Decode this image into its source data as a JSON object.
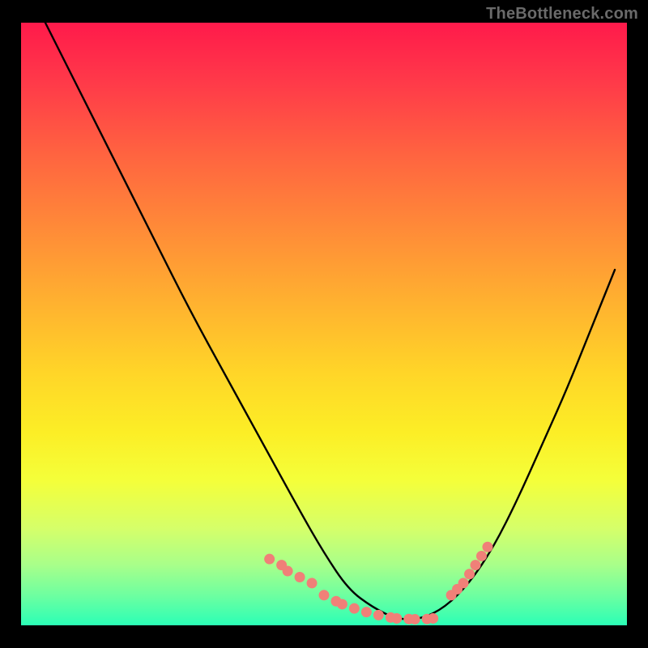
{
  "watermark": "TheBottleneck.com",
  "chart_data": {
    "type": "line",
    "title": "",
    "xlabel": "",
    "ylabel": "",
    "xlim": [
      0,
      100
    ],
    "ylim": [
      0,
      100
    ],
    "grid": false,
    "series": [
      {
        "name": "bottleneck-curve",
        "color": "#000000",
        "x": [
          4,
          10,
          16,
          22,
          28,
          34,
          40,
          46,
          50,
          54,
          58,
          62,
          66,
          70,
          74,
          78,
          82,
          86,
          90,
          94,
          98
        ],
        "y": [
          100,
          88,
          76,
          64,
          52,
          41,
          30,
          19,
          12,
          6,
          3,
          1,
          1,
          3,
          7,
          13,
          21,
          30,
          39,
          49,
          59
        ]
      }
    ],
    "markers": [
      {
        "name": "left-cluster",
        "color": "#f08078",
        "shape": "circle",
        "x": [
          41,
          43,
          44,
          46,
          48,
          50,
          52,
          53,
          55,
          57,
          59,
          61,
          62,
          64,
          65,
          67,
          68
        ],
        "y": [
          11,
          10,
          9,
          8,
          7,
          5,
          4,
          3.5,
          2.8,
          2.2,
          1.7,
          1.3,
          1.15,
          1.05,
          1.0,
          1.05,
          1.15
        ]
      },
      {
        "name": "right-cluster",
        "color": "#f08078",
        "shape": "circle",
        "x": [
          71,
          72,
          73,
          74,
          75,
          76,
          77
        ],
        "y": [
          5,
          6,
          7,
          8.5,
          10,
          11.5,
          13
        ]
      }
    ],
    "background_gradient": {
      "stops": [
        {
          "pos": 0.0,
          "color": "#ff1a4b"
        },
        {
          "pos": 0.22,
          "color": "#ff6440"
        },
        {
          "pos": 0.46,
          "color": "#ffb030"
        },
        {
          "pos": 0.68,
          "color": "#fcee26"
        },
        {
          "pos": 0.84,
          "color": "#d5ff6a"
        },
        {
          "pos": 1.0,
          "color": "#2bffb6"
        }
      ]
    }
  }
}
